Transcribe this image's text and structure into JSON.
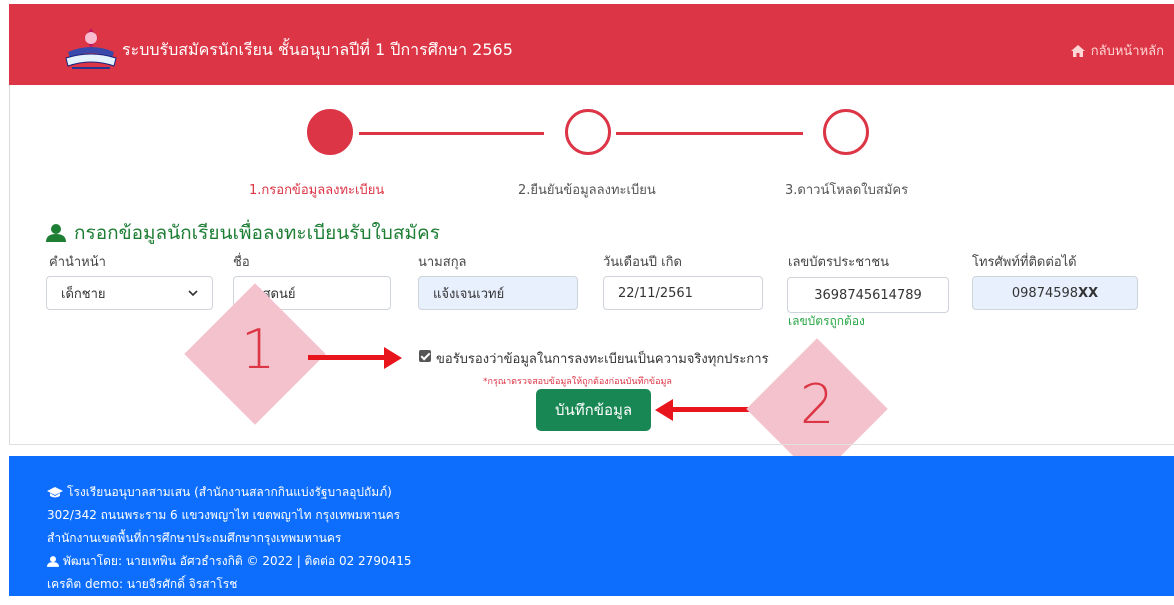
{
  "header": {
    "title": "ระบบรับสมัครนักเรียน ชั้นอนุบาลปีที่ 1 ปีการศึกษา 2565",
    "home_label": "กลับหน้าหลัก",
    "home_icon": "home-icon",
    "logo_icon": "school-emblem"
  },
  "steps": [
    {
      "label": "1.กรอกข้อมูลลงทะเบียน",
      "state": "active"
    },
    {
      "label": "2.ยืนยันข้อมูลลงทะเบียน",
      "state": "pending"
    },
    {
      "label": "3.ดาวน์โหลดใบสมัคร",
      "state": "pending"
    }
  ],
  "form": {
    "section_title": "กรอกข้อมูลนักเรียนเพื่อลงทะเบียนรับใบสมัคร",
    "section_icon": "user-icon",
    "fields": {
      "prefix": {
        "label": "คำนำหน้า",
        "value": "เด็กชาย"
      },
      "first_name": {
        "label": "ชื่อ",
        "value": "วริศดนย์"
      },
      "last_name": {
        "label": "นามสกุล",
        "value": "แจ้งเจนเวทย์"
      },
      "birth_date": {
        "label": "วันเดือนปี เกิด",
        "value": "22/11/2561"
      },
      "id_card": {
        "label": "เลขบัตรประชาชน",
        "value": "3698745614789",
        "valid_text": "เลขบัตรถูกต้อง"
      },
      "phone": {
        "label": "โทรศัพท์ที่ติดต่อได้",
        "value": "09874598",
        "value_bold": "XX"
      }
    },
    "consent_label": "ขอรับรองว่าข้อมูลในการลงทะเบียนเป็นความจริงทุกประการ",
    "consent_checked": true,
    "warning": "*กรุณาตรวจสอบข้อมูลให้ถูกต้องก่อนบันทึกข้อมูล",
    "save_label": "บันทึกข้อมูล"
  },
  "annotations": {
    "marker_1": "1",
    "marker_2": "2"
  },
  "footer": {
    "school": "โรงเรียนอนุบาลสามเสน (สำนักงานสลากกินแบ่งรัฐบาลอุปถัมภ์)",
    "address": "302/342 ถนนพระราม 6 แขวงพญาไท เขตพญาไท กรุงเทพมหานคร",
    "district": "สำนักงานเขตพื้นที่การศึกษาประถมศึกษากรุงเทพมหานคร",
    "developer": "พัฒนาโดย: นายเทพิน อัศวธำรงกิติ © 2022 | ติดต่อ 02 2790415",
    "credit": "เครดิต demo: นายจีรศักดิ์ จิรสาโรช"
  },
  "colors": {
    "header": "#dc3545",
    "footer": "#0d6efd",
    "save_button": "#198754",
    "section_title": "#1e7e34"
  }
}
